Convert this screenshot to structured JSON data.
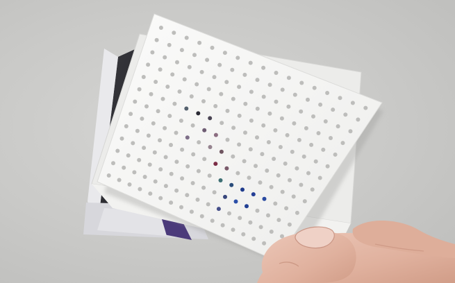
{
  "scene": {
    "subject": "perforated-card-stack",
    "background_color": "#c9c9c7",
    "card_color": "#f7f7f5",
    "hole_shadow_color": "#bdbdbb",
    "skin_color": "#e2b7a6",
    "visible_text": []
  }
}
